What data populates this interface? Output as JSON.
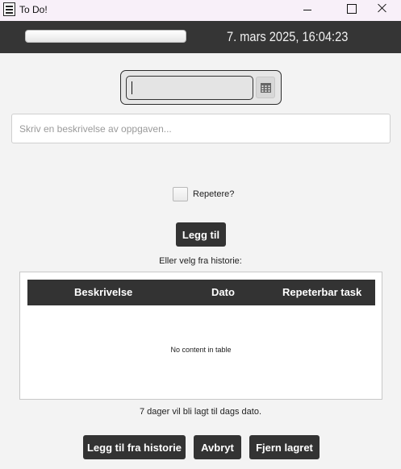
{
  "window": {
    "title": "To Do!",
    "icon": "todo-list-icon"
  },
  "header": {
    "progress": 0,
    "datetime": "7. mars 2025, 16:04:23"
  },
  "form": {
    "date_value": "",
    "calendar_icon": "calendar-icon",
    "description_placeholder": "Skriv en beskrivelse av oppgaven...",
    "description_value": "",
    "repeat_label": "Repetere?",
    "repeat_checked": false,
    "add_button": "Legg til",
    "history_label": "Eller velg fra historie:"
  },
  "table": {
    "columns": [
      "Beskrivelse",
      "Dato",
      "Repeterbar task"
    ],
    "rows": [],
    "empty_text": "No content in table"
  },
  "footer": {
    "info": "7 dager vil bli lagt til dags dato.",
    "add_history_button": "Legg til fra historie",
    "cancel_button": "Avbryt",
    "remove_saved_button": "Fjern lagret"
  },
  "colors": {
    "dark": "#333333",
    "header_bg": "#353535",
    "titlebar_bg": "#f8f0f9",
    "background": "#f3f3f3"
  }
}
